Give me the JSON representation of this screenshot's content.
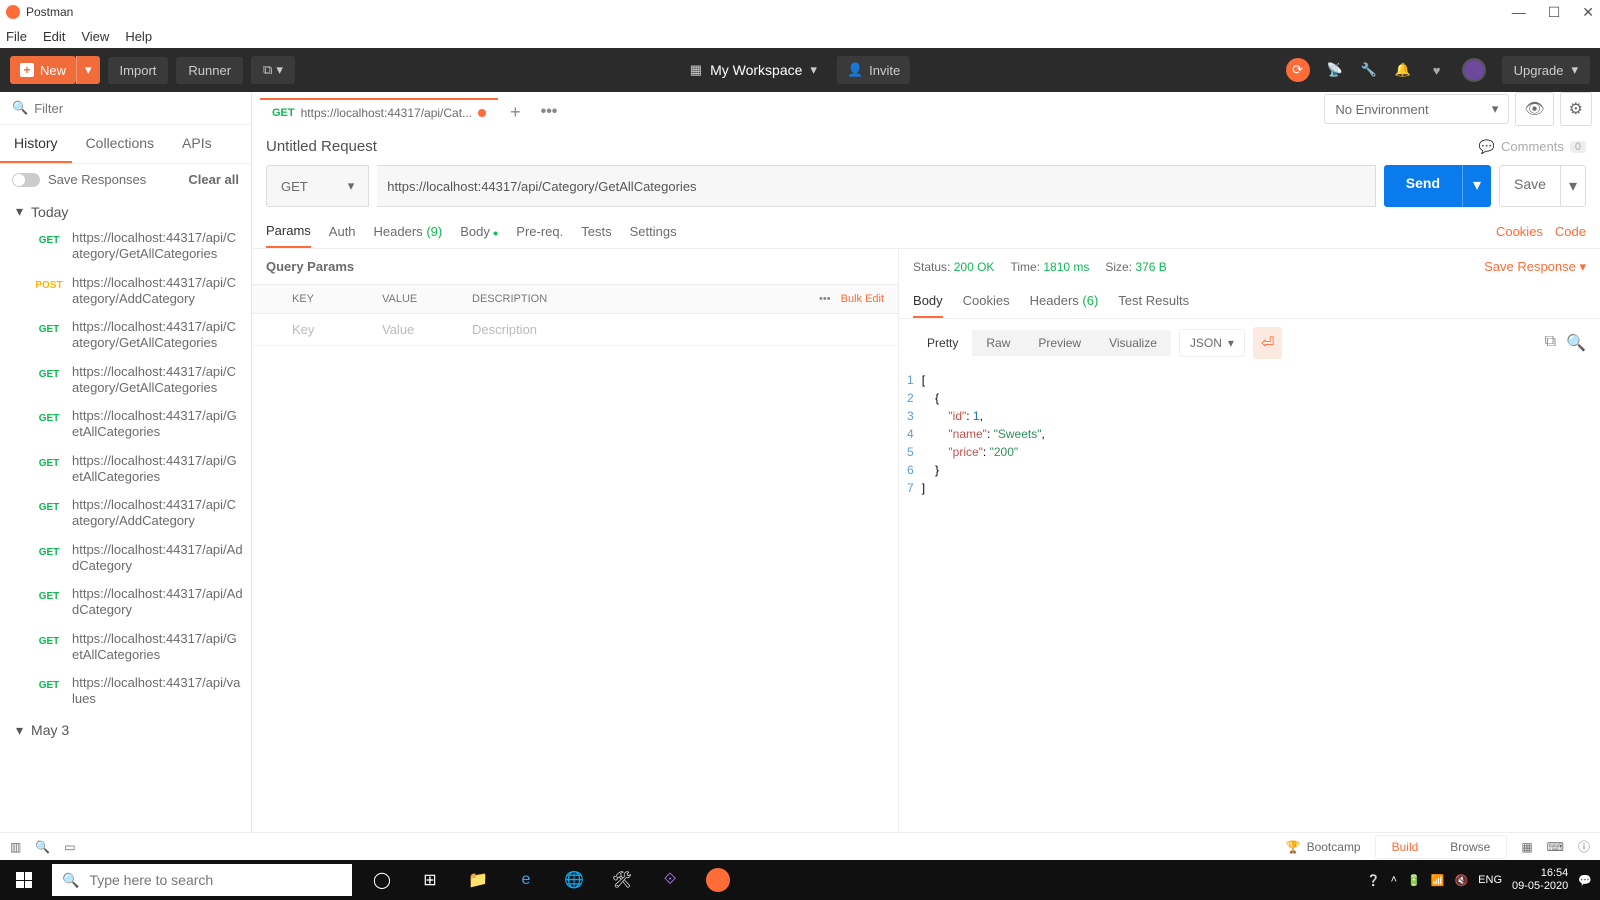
{
  "titlebar": {
    "app_name": "Postman"
  },
  "menubar": [
    "File",
    "Edit",
    "View",
    "Help"
  ],
  "toolbar": {
    "new": "New",
    "import": "Import",
    "runner": "Runner",
    "workspace": "My Workspace",
    "invite": "Invite",
    "upgrade": "Upgrade"
  },
  "sidebar": {
    "filter_placeholder": "Filter",
    "tabs": [
      "History",
      "Collections",
      "APIs"
    ],
    "active_tab": 0,
    "save_responses": "Save Responses",
    "clear_all": "Clear all",
    "groups": [
      {
        "label": "Today",
        "items": [
          {
            "method": "GET",
            "url": "https://localhost:44317/api/Category/GetAllCategories"
          },
          {
            "method": "POST",
            "url": "https://localhost:44317/api/Category/AddCategory"
          },
          {
            "method": "GET",
            "url": "https://localhost:44317/api/Category/GetAllCategories"
          },
          {
            "method": "GET",
            "url": "https://localhost:44317/api/Category/GetAllCategories"
          },
          {
            "method": "GET",
            "url": "https://localhost:44317/api/GetAllCategories"
          },
          {
            "method": "GET",
            "url": "https://localhost:44317/api/GetAllCategories"
          },
          {
            "method": "GET",
            "url": "https://localhost:44317/api/Category/AddCategory"
          },
          {
            "method": "GET",
            "url": "https://localhost:44317/api/AddCategory"
          },
          {
            "method": "GET",
            "url": "https://localhost:44317/api/AddCategory"
          },
          {
            "method": "GET",
            "url": "https://localhost:44317/api/GetAllCategories"
          },
          {
            "method": "GET",
            "url": "https://localhost:44317/api/values"
          }
        ]
      },
      {
        "label": "May 3",
        "items": []
      }
    ]
  },
  "tab": {
    "method": "GET",
    "label": "https://localhost:44317/api/Cat..."
  },
  "env": {
    "selected": "No Environment"
  },
  "request": {
    "title": "Untitled Request",
    "comments_label": "Comments",
    "comments_count": "0",
    "method": "GET",
    "url": "https://localhost:44317/api/Category/GetAllCategories",
    "send": "Send",
    "save": "Save",
    "tabs": {
      "params": "Params",
      "auth": "Auth",
      "headers": "Headers",
      "headers_count": "(9)",
      "body": "Body",
      "prereq": "Pre-req.",
      "tests": "Tests",
      "settings": "Settings",
      "cookies": "Cookies",
      "code": "Code"
    },
    "query_params_title": "Query Params",
    "kv_headers": {
      "key": "KEY",
      "value": "VALUE",
      "desc": "DESCRIPTION",
      "bulk": "Bulk Edit"
    },
    "kv_placeholders": {
      "key": "Key",
      "value": "Value",
      "desc": "Description"
    }
  },
  "response": {
    "status_label": "Status:",
    "status_value": "200 OK",
    "time_label": "Time:",
    "time_value": "1810 ms",
    "size_label": "Size:",
    "size_value": "376 B",
    "save_response": "Save Response",
    "tabs": {
      "body": "Body",
      "cookies": "Cookies",
      "headers": "Headers",
      "headers_count": "(6)",
      "tests": "Test Results"
    },
    "view": {
      "pretty": "Pretty",
      "raw": "Raw",
      "preview": "Preview",
      "visualize": "Visualize",
      "format": "JSON"
    },
    "json_lines": [
      "[",
      "    {",
      "        \"id\": 1,",
      "        \"name\": \"Sweets\",",
      "        \"price\": \"200\"",
      "    }",
      "]"
    ],
    "json_body": [
      {
        "id": 1,
        "name": "Sweets",
        "price": "200"
      }
    ]
  },
  "statusbar": {
    "bootcamp": "Bootcamp",
    "build": "Build",
    "browse": "Browse"
  },
  "taskbar": {
    "search_placeholder": "Type here to search",
    "lang": "ENG",
    "time": "16:54",
    "date": "09-05-2020"
  }
}
